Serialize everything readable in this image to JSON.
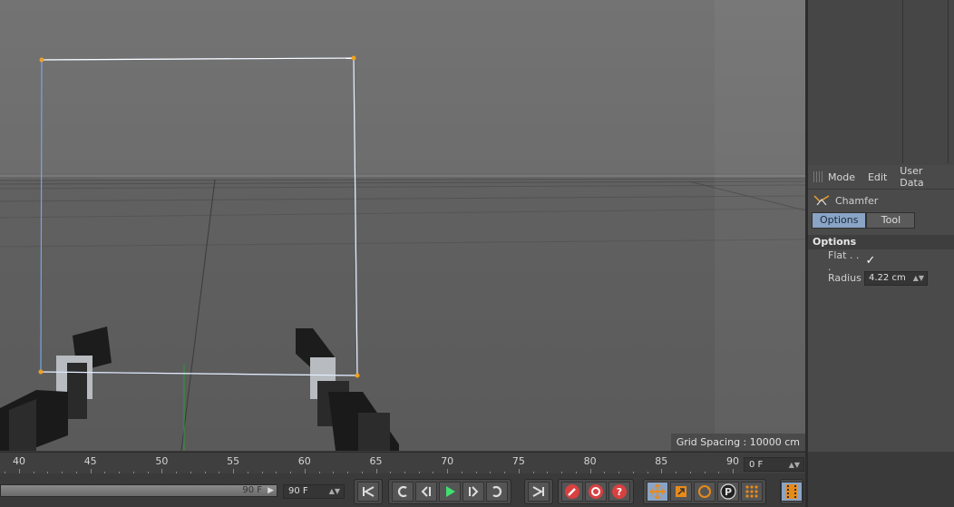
{
  "viewport": {
    "grid_label": "Grid Spacing : 10000 cm"
  },
  "attributes": {
    "menu": [
      "Mode",
      "Edit",
      "User Data"
    ],
    "tool_name": "Chamfer",
    "tabs": [
      "Options",
      "Tool"
    ],
    "section_title": "Options",
    "flat_label": "Flat . . .",
    "flat_checked": true,
    "radius_label": "Radius",
    "radius_value": "4.22 cm"
  },
  "timeline": {
    "ticks": [
      "40",
      "45",
      "50",
      "55",
      "60",
      "65",
      "70",
      "75",
      "80",
      "85",
      "90"
    ],
    "current_frame": "0 F"
  },
  "transport": {
    "slider_value": "90 F",
    "max_frame": "90 F"
  },
  "icons": {
    "go_start": "go-to-start-icon",
    "prev_key": "previous-keyframe-icon",
    "step_back": "step-back-icon",
    "play": "play-icon",
    "step_fwd": "step-forward-icon",
    "next_key": "next-keyframe-icon",
    "go_end": "go-to-end-icon",
    "record": "record-icon",
    "autokey": "autokey-icon",
    "keyhelp": "keyframe-selection-icon",
    "move": "move-icon",
    "scale": "scale-icon",
    "rotate": "rotate-icon",
    "param": "parameter-icon",
    "points": "point-level-icon",
    "film": "film-icon"
  },
  "colors": {
    "accent": "#8aa4c6",
    "play": "#40e070",
    "record": "#d94040",
    "orange": "#e88a1a"
  }
}
